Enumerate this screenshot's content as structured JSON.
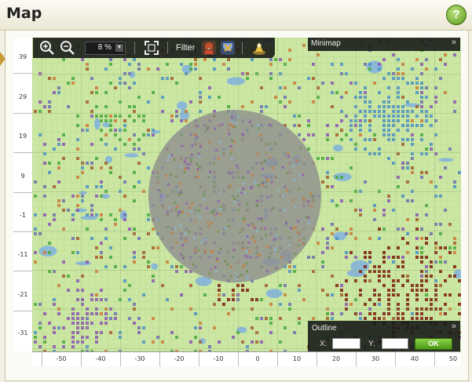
{
  "header": {
    "title": "Map",
    "help_label": "?"
  },
  "toolbar": {
    "zoom_in": "zoom-in-icon",
    "zoom_out": "zoom-out-icon",
    "zoom_level": "8 %",
    "fullscreen": "fullscreen-icon",
    "filter_label": "Filter",
    "filters": [
      "player-filter-icon",
      "alliance-filter-icon",
      "npc-filter-icon"
    ]
  },
  "minimap": {
    "label": "Minimap",
    "toggle": "»"
  },
  "outline": {
    "label": "Outline",
    "toggle": "»",
    "x_label": "X:",
    "y_label": "Y:",
    "x_value": "",
    "y_value": "",
    "ok_label": "OK"
  },
  "axes": {
    "y_ticks": [
      "39",
      "29",
      "19",
      "9",
      "-1",
      "-11",
      "-21",
      "-31"
    ],
    "x_ticks": [
      "-50",
      "-40",
      "-30",
      "-20",
      "-10",
      "0",
      "10",
      "20",
      "30",
      "40",
      "50"
    ]
  },
  "colors": {
    "terrain": "#c9e6a0",
    "highlight_zone": "#8f8f8f",
    "water": "#8ab8d6",
    "enemy": "#7e1c10",
    "alliance_blue": "#4d8fc4",
    "village_orange": "#cc7a3a",
    "village_purple": "#8c56b3",
    "village_green": "#49a83c"
  }
}
